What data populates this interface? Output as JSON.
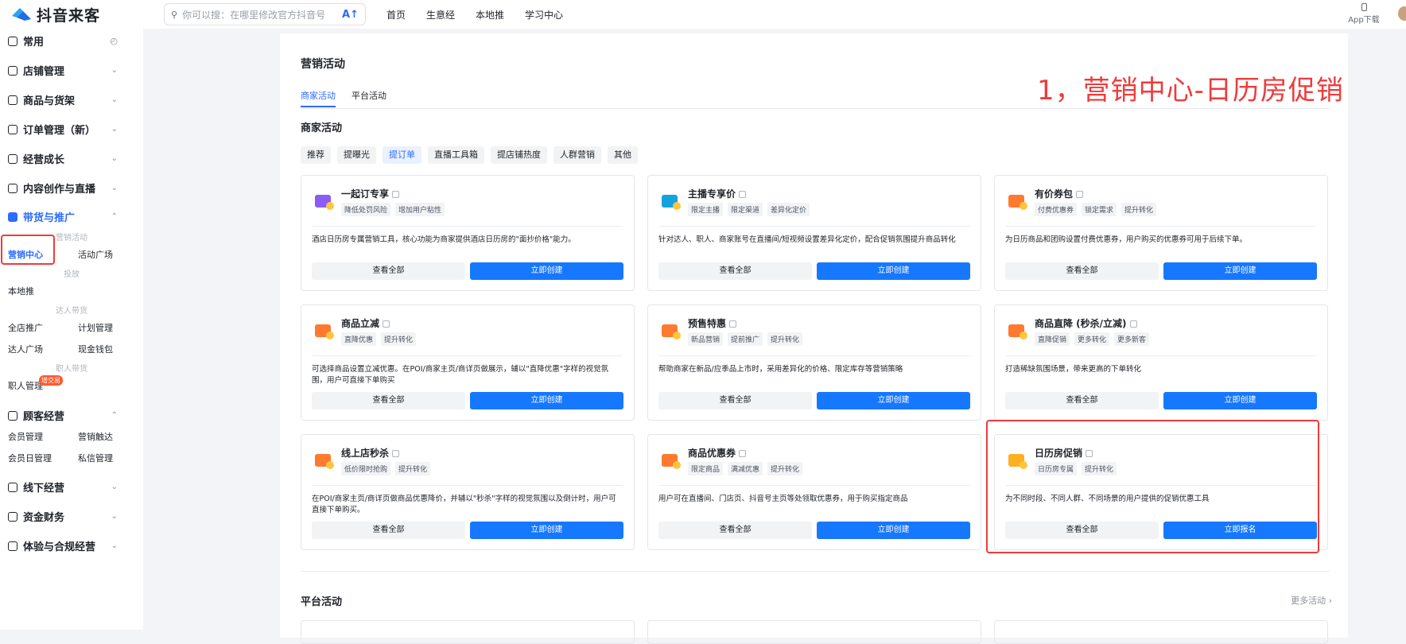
{
  "topbar": {
    "brand": "抖音来客",
    "search_placeholder": "你可以搜：在哪里修改官方抖音号",
    "ai_label": "A↑",
    "nav": [
      "首页",
      "生意经",
      "本地推",
      "学习中心"
    ],
    "app_download": "App下载"
  },
  "sidebar": {
    "groups": [
      {
        "label": "常用",
        "icon": "grid-icon"
      },
      {
        "label": "店铺管理",
        "icon": "store-icon"
      },
      {
        "label": "商品与货架",
        "icon": "bag-icon"
      },
      {
        "label": "订单管理（新）",
        "icon": "order-icon"
      },
      {
        "label": "经营成长",
        "icon": "growth-icon"
      },
      {
        "label": "内容创作与直播",
        "icon": "play-icon"
      },
      {
        "label": "带货与推广",
        "icon": "megaphone-icon"
      },
      {
        "label": "顾客经营",
        "icon": "users-icon"
      },
      {
        "label": "线下经营",
        "icon": "shop-icon"
      },
      {
        "label": "资金财务",
        "icon": "wallet-icon"
      },
      {
        "label": "体验与合规经营",
        "icon": "shield-icon"
      }
    ],
    "sub_headers": [
      "营销活动",
      "投放",
      "达人带货",
      "职人带货"
    ],
    "items": {
      "marketing_center": "营销中心",
      "activity_plaza": "活动广场",
      "local_push": "本地推",
      "store_promo": "全店推广",
      "plan_mgmt": "计划管理",
      "talent_plaza": "达人广场",
      "cash_wallet": "现金钱包",
      "staff_mgmt": "职人管理",
      "staff_badge": "增交易",
      "member_mgmt": "会员管理",
      "marketing_reach": "营销触达",
      "member_day": "会员日管理",
      "private_msg": "私信管理"
    }
  },
  "main": {
    "title": "营销活动",
    "tabs": [
      "商家活动",
      "平台活动"
    ],
    "annotation": "1，营销中心-日历房促销",
    "section_title": "商家活动",
    "chips": [
      "推荐",
      "提曝光",
      "提订单",
      "直播工具箱",
      "提店铺热度",
      "人群营销",
      "其他"
    ],
    "cards": [
      {
        "title": "一起订专享",
        "tags": [
          "降低处罚风险",
          "增加用户粘性"
        ],
        "desc": "酒店日历房专属营销工具，核心功能为商家提供酒店日历房的\"面抄价格\"能力。",
        "btn_view": "查看全部",
        "btn_action": "立即创建",
        "color": "#8b5cf6"
      },
      {
        "title": "主播专享价",
        "tags": [
          "限定主播",
          "限定渠道",
          "差异化定价"
        ],
        "desc": "针对达人、职人、商家账号在直播间/短视频设置差异化定价，配合促销氛围提升商品转化",
        "btn_view": "查看全部",
        "btn_action": "立即创建",
        "color": "#14a3e0"
      },
      {
        "title": "有价券包",
        "tags": [
          "付费优惠券",
          "锁定需求",
          "提升转化"
        ],
        "desc": "为日历商品和团购设置付费优惠券，用户购买的优惠券可用于后续下单。",
        "btn_view": "查看全部",
        "btn_action": "立即创建",
        "color": "#ff7a2e"
      },
      {
        "title": "商品立减",
        "tags": [
          "直降优惠",
          "提升转化"
        ],
        "desc": "可选择商品设置立减优惠。在POI/商家主页/商详页做展示，辅以\"直降优惠\"字样的视觉氛围，用户可直接下单购买",
        "btn_view": "查看全部",
        "btn_action": "立即创建",
        "color": "#ff7a2e"
      },
      {
        "title": "预售特惠",
        "tags": [
          "新品营销",
          "提前推广",
          "提升转化"
        ],
        "desc": "帮助商家在新品/应季品上市时，采用差异化的价格、限定库存等营销策略",
        "btn_view": "查看全部",
        "btn_action": "立即创建",
        "color": "#ff7a2e"
      },
      {
        "title": "商品直降 (秒杀/立减)",
        "tags": [
          "直降促销",
          "更多转化",
          "更多新客"
        ],
        "desc": "打造稀缺氛围场景，带来更高的下单转化",
        "btn_view": "查看全部",
        "btn_action": "立即创建",
        "color": "#ff7a2e"
      },
      {
        "title": "线上店秒杀",
        "tags": [
          "低价限时抢购",
          "提升转化"
        ],
        "desc": "在POI/商家主页/商详页做商品优惠降价，并辅以\"秒杀\"字样的视觉氛围以及倒计时，用户可直接下单购买。",
        "btn_view": "查看全部",
        "btn_action": "立即创建",
        "color": "#ff7a2e"
      },
      {
        "title": "商品优惠券",
        "tags": [
          "限定商品",
          "满减优惠",
          "提升转化"
        ],
        "desc": "用户可在直播间、门店页、抖音号主页等处领取优惠券，用于购买指定商品",
        "btn_view": "查看全部",
        "btn_action": "立即创建",
        "color": "#ff7a2e"
      },
      {
        "title": "日历房促销",
        "tags": [
          "日历房专属",
          "提升转化"
        ],
        "desc": "为不同时段、不同人群、不同场景的用户提供的促销优惠工具",
        "btn_view": "查看全部",
        "btn_action": "立即报名",
        "color": "#ffb020"
      }
    ],
    "platform_title": "平台活动",
    "more_link": "更多活动 ›"
  }
}
